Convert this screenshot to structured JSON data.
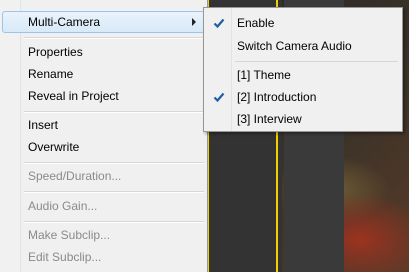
{
  "context_menu": {
    "items": [
      {
        "label": "Multi-Camera",
        "has_submenu": true,
        "state": "active"
      },
      {
        "label": "Properties",
        "state": "enabled"
      },
      {
        "label": "Rename",
        "state": "enabled"
      },
      {
        "label": "Reveal in Project",
        "state": "enabled"
      },
      {
        "label": "Insert",
        "state": "enabled"
      },
      {
        "label": "Overwrite",
        "state": "enabled"
      },
      {
        "label": "Speed/Duration...",
        "state": "disabled"
      },
      {
        "label": "Audio Gain...",
        "state": "disabled"
      },
      {
        "label": "Make Subclip...",
        "state": "disabled"
      },
      {
        "label": "Edit Subclip...",
        "state": "disabled"
      }
    ]
  },
  "submenu": {
    "items": [
      {
        "label": "Enable",
        "checked": true
      },
      {
        "label": "Switch Camera Audio",
        "checked": false
      },
      {
        "label": "[1] Theme",
        "checked": false
      },
      {
        "label": "[2] Introduction",
        "checked": true
      },
      {
        "label": "[3] Interview",
        "checked": false
      }
    ]
  },
  "icons": {
    "check": "checkmark-icon",
    "submenu_arrow": "chevron-right-icon"
  },
  "colors": {
    "highlight": "#d8e9f8",
    "highlight_border": "#9ac4ea",
    "check": "#1f5fa8",
    "playhead": "#f0d000",
    "disabled_text": "#8a8a8a"
  }
}
